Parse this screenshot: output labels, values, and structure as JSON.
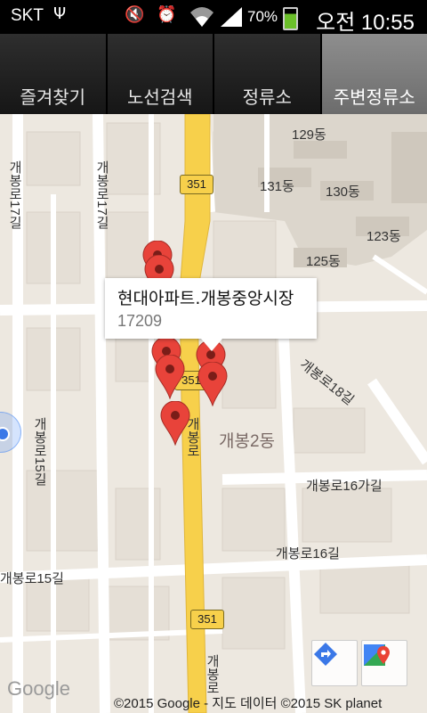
{
  "status_bar": {
    "carrier": "SKT",
    "battery_percent": "70%",
    "time": "오전 10:55",
    "icons": [
      "usb-icon",
      "mute-icon",
      "alarm-icon",
      "wifi-icon",
      "signal-icon",
      "battery-charging-icon"
    ]
  },
  "tabs": [
    {
      "label": "즐겨찾기",
      "active": false
    },
    {
      "label": "노선검색",
      "active": false
    },
    {
      "label": "정류소",
      "active": false
    },
    {
      "label": "주변정류소",
      "active": true
    }
  ],
  "map": {
    "road_labels": {
      "gaebong_17gil_left": "개봉로17길",
      "gaebong_17gil_mid": "개봉로17길",
      "gaebong_15gil_v": "개봉로15길",
      "gaebong_15gil_h": "개봉로15길",
      "gaebong_18gil": "개봉로18길",
      "gaebong_16gagil": "개봉로16가길",
      "gaebong_16gil": "개봉로16길",
      "gaebong_ro_center": "개봉로",
      "gaebong_ro_bottom": "개봉로"
    },
    "building_labels": {
      "b129": "129동",
      "b131": "131동",
      "b130": "130동",
      "b123": "123동",
      "b125": "125동"
    },
    "district_label": "개봉2동",
    "route_shields": [
      "351",
      "351",
      "351"
    ],
    "info_window": {
      "title": "현대아파트.개봉중앙시장",
      "code": "17209"
    },
    "google_logo": "Google",
    "copyright": "©2015 Google - 지도 데이터 ©2015 SK planet",
    "colors": {
      "main_road": "#f7d04b",
      "pin": "#e8433a",
      "my_location": "#3b78e7"
    }
  }
}
